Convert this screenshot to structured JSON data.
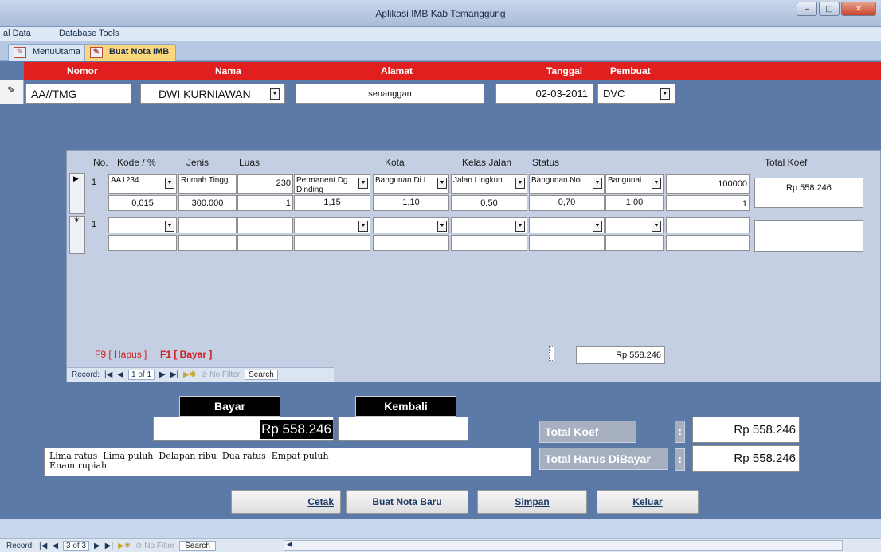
{
  "window": {
    "title": "Aplikasi IMB Kab Temanggung",
    "minimize": "–",
    "maximize": "□",
    "close": "✕"
  },
  "menu": {
    "item1": "al Data",
    "item2": "Database Tools"
  },
  "tabs": [
    {
      "label": "MenuUtama",
      "icon": "form-icon"
    },
    {
      "label": "Buat Nota IMB",
      "icon": "form-icon"
    }
  ],
  "header": {
    "nomor": "Nomor",
    "nama": "Nama",
    "alamat": "Alamat",
    "tanggal": "Tanggal",
    "pembuat": "Pembuat"
  },
  "record": {
    "nomor": "AA//TMG",
    "nama": "DWI KURNIAWAN",
    "alamat": "senanggan",
    "tanggal": "02-03-2011",
    "pembuat": "DVC"
  },
  "grid": {
    "columns": [
      "No.",
      "Kode / %",
      "Jenis",
      "Luas",
      "Kota",
      "Kelas Jalan",
      "Status",
      "Total Koef"
    ],
    "row1": {
      "no": "1",
      "kode": "AA1234",
      "jenis": "Rumah Tingg",
      "luas": "230",
      "c1": "Permanent Dg Dinding",
      "c2": "Bangunan Di I",
      "c3": "Jalan Lingkun",
      "c4": "Bangunan Noi",
      "c5": "Bangunai",
      "nilai": "100000",
      "total": "Rp 558.246",
      "sub": {
        "kode": "0,015",
        "jenis": "300.000",
        "luas": "1",
        "c1": "1,15",
        "c2": "1,10",
        "c3": "0,50",
        "c4": "0,70",
        "c5": "1,00",
        "nilai": "1"
      }
    },
    "newrow": {
      "no": "1"
    },
    "footer_hapus": "F9 [ Hapus ]",
    "footer_bayar": "F1 [ Bayar ]",
    "footer_total": "Rp 558.246",
    "nav": {
      "label": "Record:",
      "pos": "1 of 1",
      "filter": "No Filter",
      "search": "Search"
    }
  },
  "payment": {
    "bayar_label": "Bayar",
    "kembali_label": "Kembali",
    "bayar_value": "Rp 558.246",
    "kembali_value": "",
    "terbilang": "Lima ratus  Lima puluh  Delapan ribu  Dua ratus  Empat puluh\nEnam rupiah",
    "total_koef_label": "Total Koef",
    "total_koef_value": "Rp 558.246",
    "total_harus_label": "Total Harus DiBayar",
    "total_harus_value": "Rp 558.246",
    "colon": ":"
  },
  "buttons": {
    "cetak": "Cetak",
    "baru": "Buat Nota Baru",
    "simpan": "Simpan",
    "keluar": "Keluar"
  },
  "status": {
    "label": "Record:",
    "pos": "3 of 3",
    "filter": "No Filter",
    "search": "Search"
  },
  "colors": {
    "header_red": "#e21f1f",
    "form_bg": "#5b7aa7",
    "subform_bg": "#c4cfe3"
  }
}
